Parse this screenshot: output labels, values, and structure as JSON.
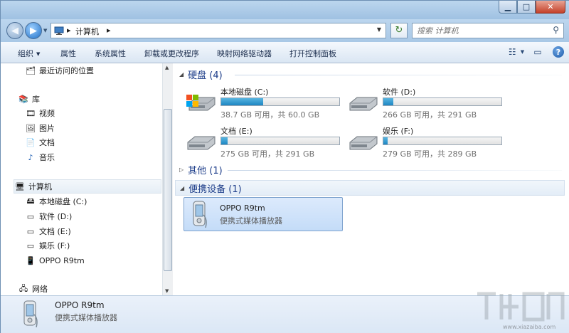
{
  "window": {
    "title": "计算机"
  },
  "address": {
    "crumbs": [
      "计算机"
    ],
    "search_placeholder": "搜索 计算机"
  },
  "toolbar": {
    "organize": "组织",
    "properties": "属性",
    "system_properties": "系统属性",
    "uninstall": "卸载或更改程序",
    "map_drive": "映射网络驱动器",
    "control_panel": "打开控制面板"
  },
  "nav": {
    "recent": "最近访问的位置",
    "library": "库",
    "videos": "视频",
    "pictures": "图片",
    "documents": "文档",
    "music": "音乐",
    "computer": "计算机",
    "drive_c": "本地磁盘 (C:)",
    "drive_d": "软件 (D:)",
    "drive_e": "文档 (E:)",
    "drive_f": "娱乐 (F:)",
    "phone": "OPPO R9tm",
    "network": "网络"
  },
  "groups": {
    "hard_disks": "硬盘 (4)",
    "other": "其他 (1)",
    "portable": "便携设备 (1)"
  },
  "drives": [
    {
      "name": "本地磁盘 (C:)",
      "info": "38.7 GB 可用，共 60.0 GB",
      "used": 0.355
    },
    {
      "name": "软件 (D:)",
      "info": "266 GB 可用，共 291 GB",
      "used": 0.086
    },
    {
      "name": "文档 (E:)",
      "info": "275 GB 可用，共 291 GB",
      "used": 0.055
    },
    {
      "name": "娱乐 (F:)",
      "info": "279 GB 可用，共 289 GB",
      "used": 0.035
    }
  ],
  "device": {
    "name": "OPPO R9tm",
    "type": "便携式媒体播放器"
  },
  "details": {
    "name": "OPPO R9tm",
    "type": "便携式媒体播放器"
  },
  "watermark": {
    "url": "www.xiazaiba.com"
  },
  "colors": {
    "accent": "#1e86c2",
    "group_header": "#1e3e8a",
    "selection": "#c4dcf8"
  }
}
